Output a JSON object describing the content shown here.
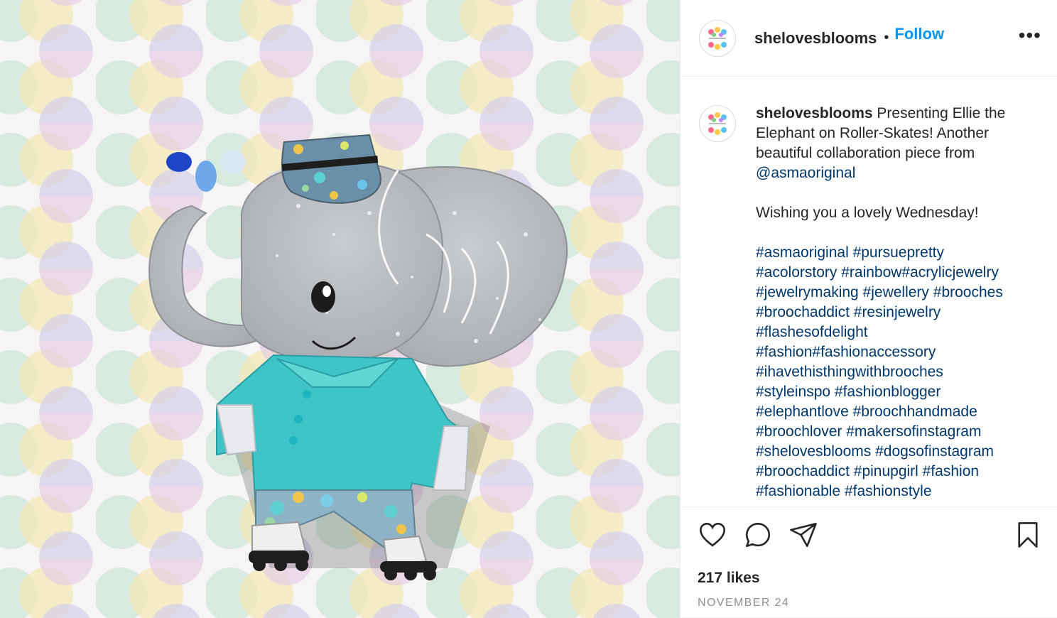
{
  "post": {
    "username": "shelovesblooms",
    "separator": "•",
    "follow_label": "Follow",
    "more_icon": "more-options-icon",
    "more_glyph": "•••"
  },
  "caption": {
    "username": "shelovesblooms",
    "text_intro": " Presenting Ellie the Elephant on Roller-Skates! Another beautiful collaboration piece from ",
    "mention": "@asmaoriginal",
    "text_wish": "\n\nWishing you a lovely Wednesday!\n\n",
    "hashtags": "#asmaoriginal #pursuepretty\n#acolorstory #rainbow#acrylicjewelry\n#jewelrymaking #jewellery #brooches\n#broochaddict #resinjewelry\n#flashesofdelight\n#fashion#fashionaccessory\n#ihavethisthingwithbrooches\n#styleinspo #fashionblogger\n#elephantlove #broochhandmade\n#broochlover #makersofinstagram\n#shelovesblooms #dogsofinstagram\n#broochaddict #pinupgirl #fashion\n#fashionable #fashionstyle"
  },
  "actions": {
    "like_icon": "heart-icon",
    "comment_icon": "comment-icon",
    "share_icon": "share-icon",
    "save_icon": "bookmark-icon"
  },
  "likes_text": "217 likes",
  "date_text": "NOVEMBER 24",
  "colors": {
    "accent": "#0095f6",
    "link": "#00376b",
    "text": "#262626",
    "muted": "#8e8e8e",
    "border": "#efefef"
  }
}
